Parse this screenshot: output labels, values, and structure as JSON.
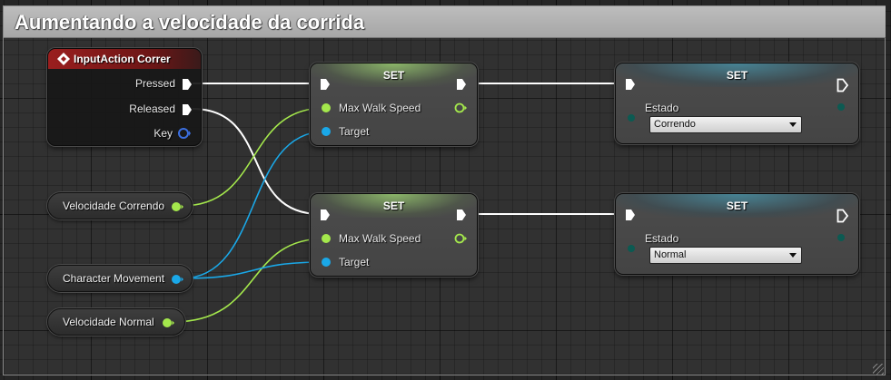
{
  "comment": {
    "title": "Aumentando a velocidade da corrida"
  },
  "input_action": {
    "title": "InputAction Correr",
    "pins": {
      "pressed": "Pressed",
      "released": "Released",
      "key": "Key"
    }
  },
  "variables": {
    "velocidade_correndo": "Velocidade Correndo",
    "character_movement": "Character Movement",
    "velocidade_normal": "Velocidade Normal"
  },
  "set_speed_top": {
    "title": "SET",
    "pins": {
      "max_walk_speed": "Max Walk Speed",
      "target": "Target"
    }
  },
  "set_speed_bottom": {
    "title": "SET",
    "pins": {
      "max_walk_speed": "Max Walk Speed",
      "target": "Target"
    }
  },
  "set_estado_top": {
    "title": "SET",
    "label": "Estado",
    "value": "Correndo"
  },
  "set_estado_bottom": {
    "title": "SET",
    "label": "Estado",
    "value": "Normal"
  },
  "colors": {
    "exec_wire": "#ffffff",
    "float_pin": "#a4e84c",
    "object_pin": "#1aa8e8",
    "enum_pin": "#0c5a52",
    "event_header": "#8e1a1a",
    "set_header": "#7ea86a",
    "enum_header": "#2e6a78",
    "key_pin": "#3b6fe0"
  }
}
